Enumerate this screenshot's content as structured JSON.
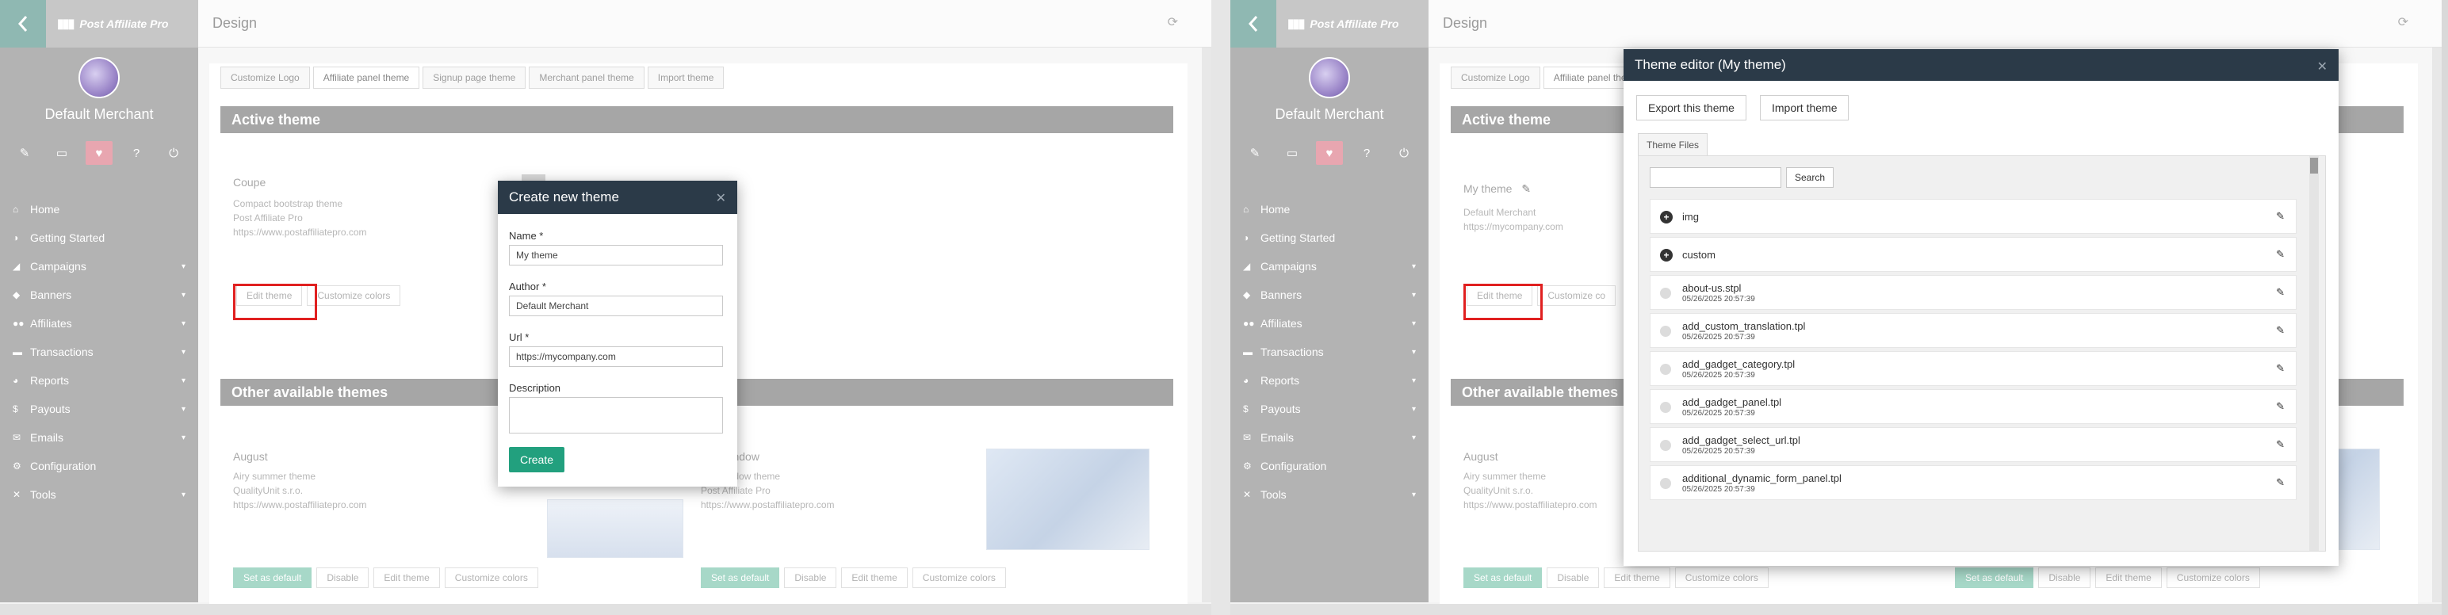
{
  "app": {
    "brand": "Post Affiliate Pro",
    "page_title": "Design",
    "merchant_name": "Default Merchant"
  },
  "menu": [
    {
      "label": "Home",
      "icon": "home-icon",
      "glyph": "⌂",
      "chevron": false
    },
    {
      "label": "Getting Started",
      "icon": "power-icon",
      "glyph": "◑",
      "chevron": false
    },
    {
      "label": "Campaigns",
      "icon": "chart-icon",
      "glyph": "◢",
      "chevron": true
    },
    {
      "label": "Banners",
      "icon": "banner-icon",
      "glyph": "◆",
      "chevron": true
    },
    {
      "label": "Affiliates",
      "icon": "users-icon",
      "glyph": "●●",
      "chevron": true
    },
    {
      "label": "Transactions",
      "icon": "cart-icon",
      "glyph": "▬",
      "chevron": true
    },
    {
      "label": "Reports",
      "icon": "pie-icon",
      "glyph": "◕",
      "chevron": true
    },
    {
      "label": "Payouts",
      "icon": "money-icon",
      "glyph": "$",
      "chevron": true
    },
    {
      "label": "Emails",
      "icon": "mail-icon",
      "glyph": "✉",
      "chevron": true
    },
    {
      "label": "Configuration",
      "icon": "gear-icon",
      "glyph": "⚙",
      "chevron": false
    },
    {
      "label": "Tools",
      "icon": "wrench-icon",
      "glyph": "✕",
      "chevron": true
    }
  ],
  "tabs": [
    "Customize Logo",
    "Affiliate panel theme",
    "Signup page theme",
    "Merchant panel theme",
    "Import theme"
  ],
  "sections": {
    "active": "Active theme",
    "other": "Other available themes"
  },
  "left": {
    "active_theme": {
      "name": "Coupe",
      "lines": [
        "Compact bootstrap theme",
        "Post Affiliate Pro",
        "https://www.postaffiliatepro.com"
      ],
      "edit_label": "Edit theme",
      "customize_label": "Customize colors"
    },
    "other_themes": [
      {
        "name": "August",
        "lines": [
          "Airy summer theme",
          "QualityUnit s.r.o.",
          "https://www.postaffiliatepro.com"
        ]
      },
      {
        "name": "ope window",
        "lines": [
          "ope window theme",
          "Post Affiliate Pro",
          "https://www.postaffiliatepro.com"
        ]
      }
    ],
    "card_buttons": {
      "default": "Set as default",
      "disable": "Disable",
      "edit": "Edit theme",
      "customize": "Customize colors"
    },
    "dialog": {
      "title": "Create new theme",
      "name_label": "Name *",
      "name_value": "My theme",
      "author_label": "Author *",
      "author_value": "Default Merchant",
      "url_label": "Url *",
      "url_value": "https://mycompany.com",
      "description_label": "Description",
      "create_label": "Create"
    }
  },
  "right": {
    "active_theme": {
      "name": "My theme",
      "lines": [
        "Default Merchant",
        "https://mycompany.com"
      ],
      "edit_label": "Edit theme",
      "customize_label": "Customize co"
    },
    "other_themes": [
      {
        "name": "August",
        "lines": [
          "Airy summer theme",
          "QualityUnit s.r.o.",
          "https://www.postaffiliatepro.com"
        ]
      }
    ],
    "editor": {
      "title": "Theme editor (My theme)",
      "export_label": "Export this theme",
      "import_label": "Import theme",
      "files_tab": "Theme Files",
      "search_label": "Search",
      "files": [
        {
          "name": "img",
          "date": "",
          "folder": true
        },
        {
          "name": "custom",
          "date": "",
          "folder": true
        },
        {
          "name": "about-us.stpl",
          "date": "05/26/2025 20:57:39",
          "folder": false
        },
        {
          "name": "add_custom_translation.tpl",
          "date": "05/26/2025 20:57:39",
          "folder": false
        },
        {
          "name": "add_gadget_category.tpl",
          "date": "05/26/2025 20:57:39",
          "folder": false
        },
        {
          "name": "add_gadget_panel.tpl",
          "date": "05/26/2025 20:57:39",
          "folder": false
        },
        {
          "name": "add_gadget_select_url.tpl",
          "date": "05/26/2025 20:57:39",
          "folder": false
        },
        {
          "name": "additional_dynamic_form_panel.tpl",
          "date": "05/26/2025 20:57:39",
          "folder": false
        }
      ]
    }
  },
  "colors": {
    "sidebar": "#b3b3b3",
    "accent_green": "#22a07e",
    "dialog_header": "#2b3a48",
    "highlight_red": "#e02020",
    "active_nav_pink": "#e8a6b0"
  }
}
